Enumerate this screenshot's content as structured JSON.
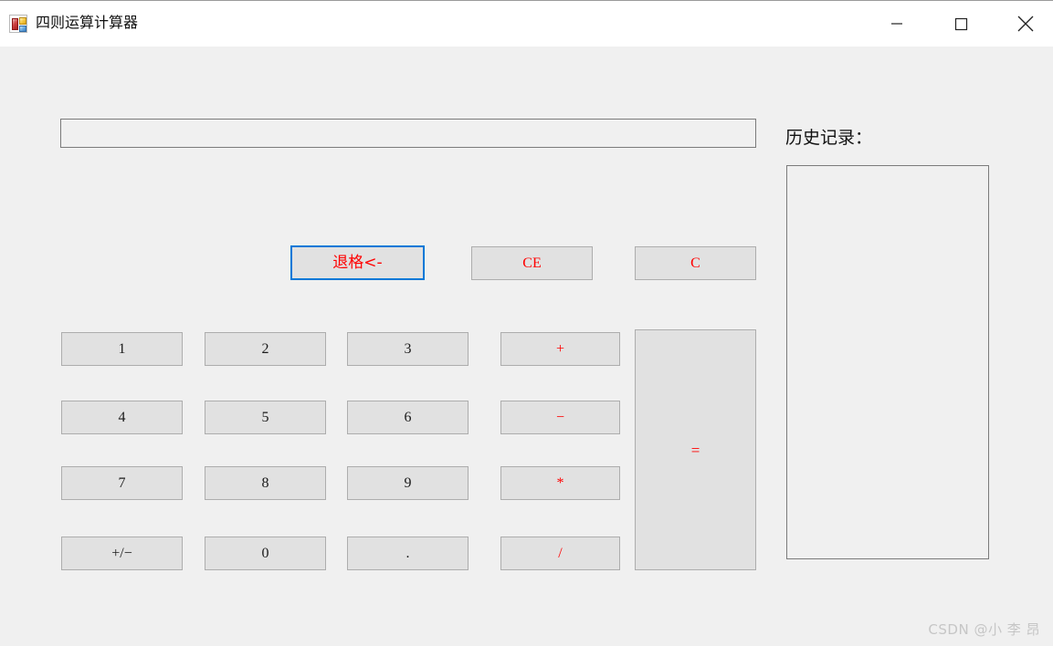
{
  "window": {
    "title": "四则运算计算器",
    "icon": "winforms-app-icon",
    "background_color": "#f0f0f0",
    "titlebar_color": "#ffffff",
    "controls": [
      {
        "name": "minimize",
        "glyph": "—"
      },
      {
        "name": "maximize",
        "glyph": "□"
      },
      {
        "name": "close",
        "glyph": "✕"
      }
    ]
  },
  "display": {
    "value": "",
    "placeholder": ""
  },
  "colors": {
    "operator_red": "#ff0000",
    "focus_blue": "#0078d7",
    "button_face": "#e1e1e1",
    "button_border": "#adadad",
    "text_black": "#1a1a1a"
  },
  "controls_row": [
    {
      "name": "backspace",
      "label": "退格<-",
      "color": "#ff0000",
      "focused": true
    },
    {
      "name": "clear-entry",
      "label": "CE",
      "color": "#ff0000",
      "focused": false
    },
    {
      "name": "clear",
      "label": "C",
      "color": "#ff0000",
      "focused": false
    }
  ],
  "keypad": {
    "rows": [
      [
        {
          "name": "digit-1",
          "label": "1",
          "kind": "digit"
        },
        {
          "name": "digit-2",
          "label": "2",
          "kind": "digit"
        },
        {
          "name": "digit-3",
          "label": "3",
          "kind": "digit"
        },
        {
          "name": "operator-plus",
          "label": "+",
          "kind": "operator"
        }
      ],
      [
        {
          "name": "digit-4",
          "label": "4",
          "kind": "digit"
        },
        {
          "name": "digit-5",
          "label": "5",
          "kind": "digit"
        },
        {
          "name": "digit-6",
          "label": "6",
          "kind": "digit"
        },
        {
          "name": "operator-minus",
          "label": "−",
          "kind": "operator"
        }
      ],
      [
        {
          "name": "digit-7",
          "label": "7",
          "kind": "digit"
        },
        {
          "name": "digit-8",
          "label": "8",
          "kind": "digit"
        },
        {
          "name": "digit-9",
          "label": "9",
          "kind": "digit"
        },
        {
          "name": "operator-multiply",
          "label": "*",
          "kind": "operator"
        }
      ],
      [
        {
          "name": "sign-toggle",
          "label": "+/−",
          "kind": "digit"
        },
        {
          "name": "digit-0",
          "label": "0",
          "kind": "digit"
        },
        {
          "name": "decimal-point",
          "label": ".",
          "kind": "digit"
        },
        {
          "name": "operator-divide",
          "label": "/",
          "kind": "operator"
        }
      ]
    ]
  },
  "equals": {
    "name": "equals",
    "label": "=",
    "color": "#ff0000"
  },
  "history": {
    "label": "历史记录：",
    "items": []
  },
  "watermark": {
    "text": "CSDN @小 李 昂"
  }
}
